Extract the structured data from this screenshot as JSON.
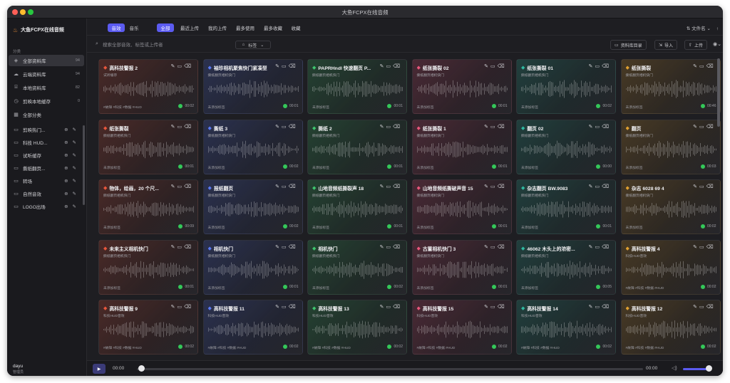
{
  "window": {
    "title": "大鱼FCPX在线音频"
  },
  "sidebar": {
    "brand": "大鱼FCPX在线音频",
    "section_label": "分类",
    "items": [
      {
        "label": "全部资料库",
        "icon": "layers-icon",
        "count": "94",
        "active": true
      },
      {
        "label": "云端资料库",
        "icon": "cloud-icon",
        "count": "94"
      },
      {
        "label": "本地资料库",
        "icon": "drive-icon",
        "count": "82"
      },
      {
        "label": "剪映本地缓存",
        "icon": "clock-icon",
        "count": "0"
      },
      {
        "label": "全部分类",
        "icon": "grid-icon",
        "count": ""
      }
    ],
    "folders": [
      {
        "label": "剪映热门..."
      },
      {
        "label": "科技 HUD..."
      },
      {
        "label": "试听缓存"
      },
      {
        "label": "撕纸翻页..."
      },
      {
        "label": "转场"
      },
      {
        "label": "自然音效"
      },
      {
        "label": "LOGO出场"
      }
    ],
    "user": {
      "name": "dayu",
      "role": "管理员"
    }
  },
  "tabs": {
    "type": [
      {
        "label": "音效",
        "active": true
      },
      {
        "label": "音乐"
      }
    ],
    "filter": [
      {
        "label": "全部",
        "active": true
      },
      {
        "label": "最近上传"
      },
      {
        "label": "我的上传"
      },
      {
        "label": "最多使用"
      },
      {
        "label": "最多收藏"
      },
      {
        "label": "收藏"
      }
    ],
    "sort_label": "文件名"
  },
  "search": {
    "placeholder": "搜索全部音效、标签或上传者",
    "tag_button": "标签"
  },
  "actions": {
    "library_button": "资料库目录",
    "import_button": "导入",
    "upload_button": "上传"
  },
  "cards": [
    {
      "title": "高科技警报 2",
      "sub": "试听缓存",
      "tags": "#故障 #科技 #数据 #HUD",
      "time": "00:02",
      "color": "#e8563c"
    },
    {
      "title": "袖珍相机聚焦快门紧凑型",
      "sub": "撕纸翻页相机快门",
      "tags": "未添加标签",
      "time": "00:01",
      "color": "#5a78f0"
    },
    {
      "title": "PAPRHndl 快速翻页 P...",
      "sub": "撕纸翻页相机快门",
      "tags": "未添加标签",
      "time": "00:01",
      "color": "#3ec46d"
    },
    {
      "title": "纸张撕裂 02",
      "sub": "撕纸翻页相机快门",
      "tags": "未添加标签",
      "time": "00:01",
      "color": "#e8567a"
    },
    {
      "title": "纸张撕裂 01",
      "sub": "撕纸翻页相机快门",
      "tags": "未添加标签",
      "time": "00:02",
      "color": "#2fb8a0"
    },
    {
      "title": "纸张撕裂",
      "sub": "撕纸翻页相机快门",
      "tags": "未添加标签",
      "time": "00:46",
      "color": "#e0a030"
    },
    {
      "title": "纸张撕裂",
      "sub": "撕纸翻页相机快门",
      "tags": "未添加标签",
      "time": "00:01",
      "color": "#e8563c"
    },
    {
      "title": "撕纸 3",
      "sub": "撕纸翻页相机快门",
      "tags": "未添加标签",
      "time": "00:02",
      "color": "#5a78f0"
    },
    {
      "title": "撕纸 2",
      "sub": "撕纸翻页相机快门",
      "tags": "未添加标签",
      "time": "00:01",
      "color": "#3ec46d"
    },
    {
      "title": "纸张撕裂 1",
      "sub": "撕纸翻页相机快门",
      "tags": "未添加标签",
      "time": "00:01",
      "color": "#e8567a"
    },
    {
      "title": "翻页 02",
      "sub": "撕纸翻页相机快门",
      "tags": "未添加标签",
      "time": "00:00",
      "color": "#2fb8a0"
    },
    {
      "title": "翻页",
      "sub": "撕纸翻页相机快门",
      "tags": "未添加标签",
      "time": "00:03",
      "color": "#e0a030"
    },
    {
      "title": "物体，绘画，20 个尺...",
      "sub": "撕纸翻页相机快门",
      "tags": "未添加标签",
      "time": "00:09",
      "color": "#e8563c"
    },
    {
      "title": "报纸翻页",
      "sub": "撕纸翻页相机快门",
      "tags": "未添加标签",
      "time": "00:02",
      "color": "#5a78f0"
    },
    {
      "title": "山地音频纸撕裂声 18",
      "sub": "撕纸翻页相机快门",
      "tags": "未添加标签",
      "time": "00:01",
      "color": "#3ec46d"
    },
    {
      "title": "山地音频纸撕破声音 15",
      "sub": "撕纸翻页相机快门",
      "tags": "未添加标签",
      "time": "00:01",
      "color": "#e8567a"
    },
    {
      "title": "杂志翻页 BW.9083",
      "sub": "撕纸翻页相机快门",
      "tags": "未添加标签",
      "time": "00:01",
      "color": "#2fb8a0"
    },
    {
      "title": "杂志 6028 69 4",
      "sub": "撕纸翻页相机快门",
      "tags": "未添加标签",
      "time": "00:02",
      "color": "#e0a030"
    },
    {
      "title": "未来主义相机快门",
      "sub": "撕纸翻页相机快门",
      "tags": "未添加标签",
      "time": "00:01",
      "color": "#e8563c"
    },
    {
      "title": "相机快门",
      "sub": "撕纸翻页相机快门",
      "tags": "未添加标签",
      "time": "00:01",
      "color": "#5a78f0"
    },
    {
      "title": "相机快门",
      "sub": "撕纸翻页相机快门",
      "tags": "未添加标签",
      "time": "00:02",
      "color": "#3ec46d"
    },
    {
      "title": "古董相机快门 3",
      "sub": "撕纸翻页相机快门",
      "tags": "未添加标签",
      "time": "00:01",
      "color": "#e8567a"
    },
    {
      "title": "46062 木头上的浓密...",
      "sub": "撕纸翻页相机快门",
      "tags": "未添加标签",
      "time": "00:05",
      "color": "#2fb8a0"
    },
    {
      "title": "高科技警报 4",
      "sub": "科技HUD音效",
      "tags": "#故障 #科技 #数据 #HUD",
      "time": "00:02",
      "color": "#e0a030"
    },
    {
      "title": "高科技警报 9",
      "sub": "科技HUD音效",
      "tags": "#故障 #科技 #数据 #HUD",
      "time": "00:02",
      "color": "#e8563c"
    },
    {
      "title": "高科技警报 11",
      "sub": "科技HUD音效",
      "tags": "#故障 #科技 #数据 #HUD",
      "time": "00:02",
      "color": "#5a78f0"
    },
    {
      "title": "高科技警报 13",
      "sub": "科技HUD音效",
      "tags": "#故障 #科技 #数据 #HUD",
      "time": "00:02",
      "color": "#3ec46d"
    },
    {
      "title": "高科技警报 15",
      "sub": "科技HUD音效",
      "tags": "#故障 #科技 #数据 #HUD",
      "time": "00:02",
      "color": "#e8567a"
    },
    {
      "title": "高科技警报 14",
      "sub": "科技HUD音效",
      "tags": "#故障 #科技 #数据 #HUD",
      "time": "00:02",
      "color": "#2fb8a0"
    },
    {
      "title": "高科技警报 12",
      "sub": "科技HUD音效",
      "tags": "#故障 #科技 #数据 #HUD",
      "time": "00:02",
      "color": "#e0a030"
    }
  ],
  "player": {
    "current": "00:00",
    "total": "00:00",
    "progress": 0,
    "volume": 0.8
  }
}
